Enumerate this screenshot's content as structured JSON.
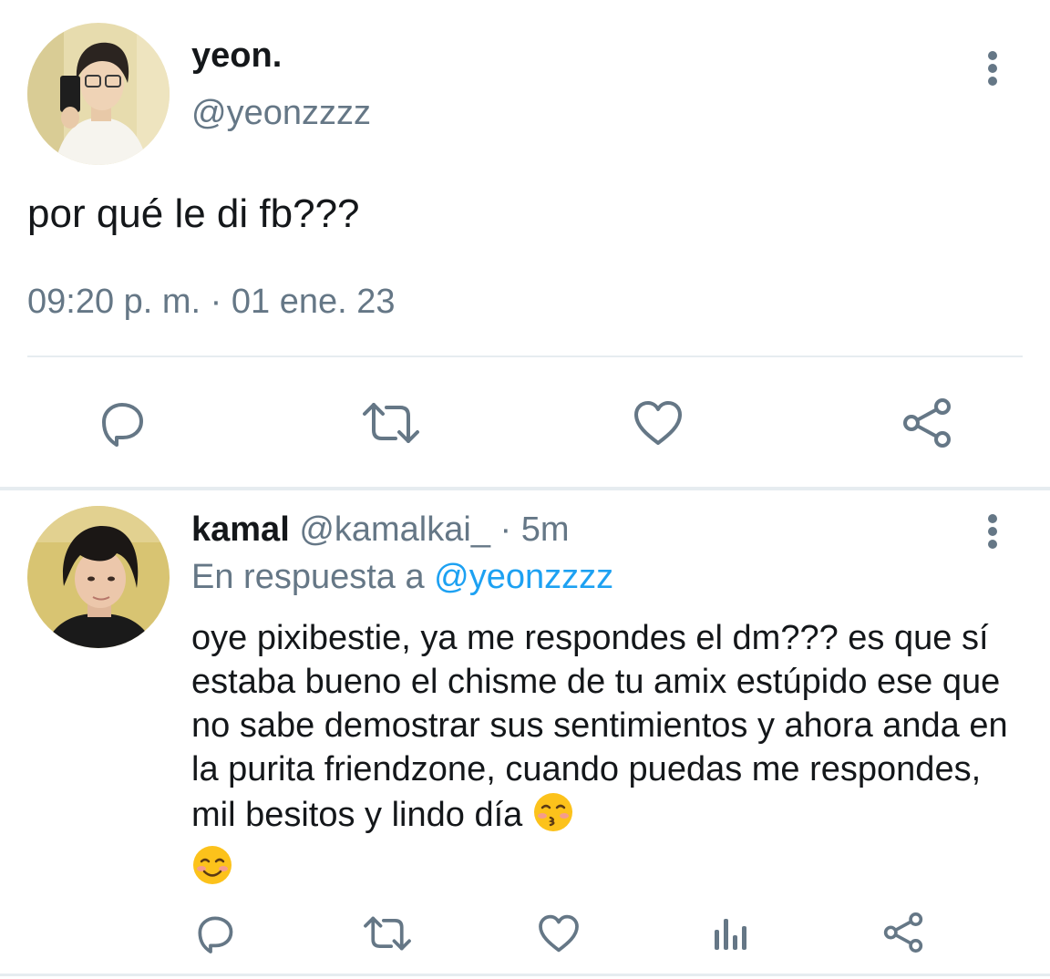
{
  "main_tweet": {
    "display_name": "yeon.",
    "handle": "@yeonzzzz",
    "text": "por qué le di fb???",
    "timestamp": "09:20 p. m. · 01 ene. 23",
    "actions": [
      "reply-icon",
      "retweet-icon",
      "like-icon",
      "share-icon"
    ]
  },
  "reply": {
    "display_name": "kamal",
    "handle": "@kamalkai_",
    "separator": "·",
    "time": "5m",
    "reply_prefix": "En respuesta a",
    "reply_mention": "@yeonzzzz",
    "text": "oye pixibestie, ya me respondes el dm??? es que sí estaba bueno el chisme de tu amix estúpido ese que no sabe demostrar sus sentimientos y ahora anda en la purita friendzone, cuando puedas me respondes, mil besitos y lindo día",
    "emojis": [
      "kissing-face-emoji",
      "smiling-face-emoji"
    ],
    "actions": [
      "reply-icon",
      "retweet-icon",
      "like-icon",
      "analytics-icon",
      "share-icon"
    ]
  },
  "colors": {
    "text_primary": "#14171a",
    "text_secondary": "#657786",
    "accent": "#1da1f2",
    "divider": "#e6ecf0"
  }
}
